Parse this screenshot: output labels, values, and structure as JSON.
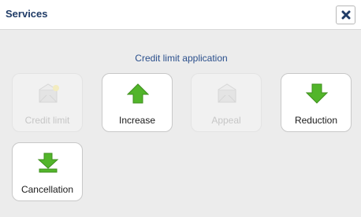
{
  "dialog": {
    "title": "Services",
    "close_icon": "close-x-icon"
  },
  "section": {
    "heading": "Credit limit application"
  },
  "services": [
    {
      "label": "Credit limit",
      "icon": "envelope-icon",
      "enabled": false
    },
    {
      "label": "Increase",
      "icon": "arrow-up-icon",
      "enabled": true
    },
    {
      "label": "Appeal",
      "icon": "envelope-icon",
      "enabled": false
    },
    {
      "label": "Reduction",
      "icon": "arrow-down-icon",
      "enabled": true
    },
    {
      "label": "Cancellation",
      "icon": "arrow-down-bar-icon",
      "enabled": true
    }
  ],
  "colors": {
    "title": "#1f3b66",
    "heading": "#2a4f8c",
    "arrow_green": "#52b52a",
    "disabled_text": "#c6c6c6"
  }
}
